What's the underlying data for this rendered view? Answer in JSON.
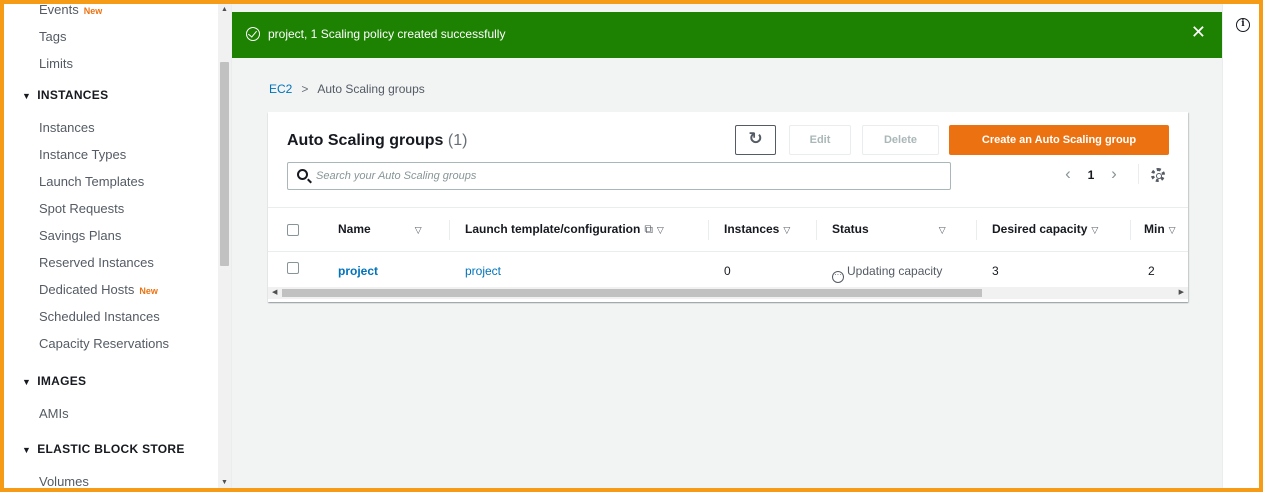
{
  "sidebar": {
    "items_top": [
      {
        "label": "Events",
        "badge": "New"
      },
      {
        "label": "Tags"
      },
      {
        "label": "Limits"
      }
    ],
    "instances_section": "INSTANCES",
    "instances_items": [
      {
        "label": "Instances"
      },
      {
        "label": "Instance Types"
      },
      {
        "label": "Launch Templates"
      },
      {
        "label": "Spot Requests"
      },
      {
        "label": "Savings Plans"
      },
      {
        "label": "Reserved Instances"
      },
      {
        "label": "Dedicated Hosts",
        "badge": "New"
      },
      {
        "label": "Scheduled Instances"
      },
      {
        "label": "Capacity Reservations"
      }
    ],
    "images_section": "IMAGES",
    "images_items": [
      {
        "label": "AMIs"
      }
    ],
    "ebs_section": "ELASTIC BLOCK STORE",
    "ebs_items": [
      {
        "label": "Volumes"
      }
    ]
  },
  "flash": {
    "message": "project, 1 Scaling policy created successfully",
    "close_glyph": "✕",
    "color": "#1d8102"
  },
  "breadcrumb": {
    "root": "EC2",
    "separator": ">",
    "current": "Auto Scaling groups"
  },
  "panel": {
    "title": "Auto Scaling groups",
    "count": "(1)",
    "refresh_glyph": "↻",
    "edit_label": "Edit",
    "delete_label": "Delete",
    "create_label": "Create an Auto Scaling group",
    "search_placeholder": "Search your Auto Scaling groups",
    "page": "1",
    "prev_glyph": "‹",
    "next_glyph": "›",
    "accent": "#ec7211"
  },
  "table": {
    "columns": {
      "name": "Name",
      "launch": "Launch template/configuration",
      "instances": "Instances",
      "status": "Status",
      "desired": "Desired capacity",
      "min": "Min"
    },
    "rows": [
      {
        "name": "project",
        "launch": "project",
        "instances": "0",
        "status": "Updating capacity",
        "desired": "3",
        "min": "2"
      }
    ]
  },
  "rail": {
    "info_glyph": "i"
  }
}
